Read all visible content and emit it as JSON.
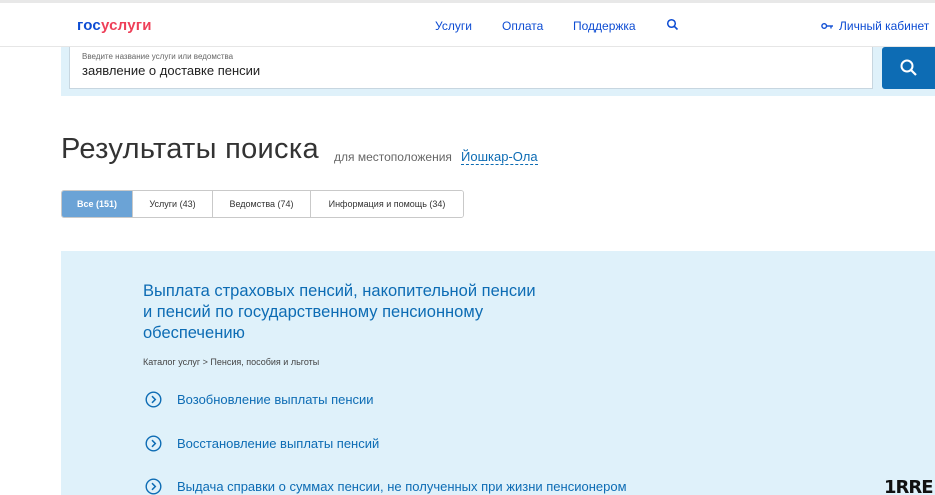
{
  "header": {
    "logo_part1": "гос",
    "logo_part2": "услуги",
    "nav": [
      "Услуги",
      "Оплата",
      "Поддержка"
    ],
    "search_icon": "search-icon",
    "cabinet_icon": "key-icon",
    "cabinet_label": "Личный кабинет"
  },
  "search": {
    "hint": "Введите название услуги или ведомства",
    "value": "заявление о доставке пенсии",
    "button_icon": "search-icon"
  },
  "results": {
    "title": "Результаты поиска",
    "subtitle": "для местоположения",
    "location": "Йошкар-Ола"
  },
  "tabs": [
    {
      "label": "Все (151)",
      "active": true
    },
    {
      "label": "Услуги (43)",
      "active": false
    },
    {
      "label": "Ведомства (74)",
      "active": false
    },
    {
      "label": "Информация и помощь (34)",
      "active": false
    }
  ],
  "panel": {
    "title": "Выплата страховых пенсий, накопительной пенсии и пенсий по государственному пенсионному обеспечению",
    "breadcrumb": "Каталог услуг > Пенсия, пособия и льготы",
    "item_icon": "chevron-circle-icon",
    "services": [
      "Возобновление выплаты пенсии",
      "Восстановление выплаты пенсий",
      "Выдача справки о суммах пенсии, не полученных при жизни пенсионером"
    ]
  },
  "watermark": "1RRE",
  "colors": {
    "brand_blue": "#0d4cd3",
    "brand_red": "#ee3f58",
    "link_blue": "#0d6cb4",
    "panel_bg": "#dff1fa",
    "tab_active": "#6ba3d6"
  }
}
